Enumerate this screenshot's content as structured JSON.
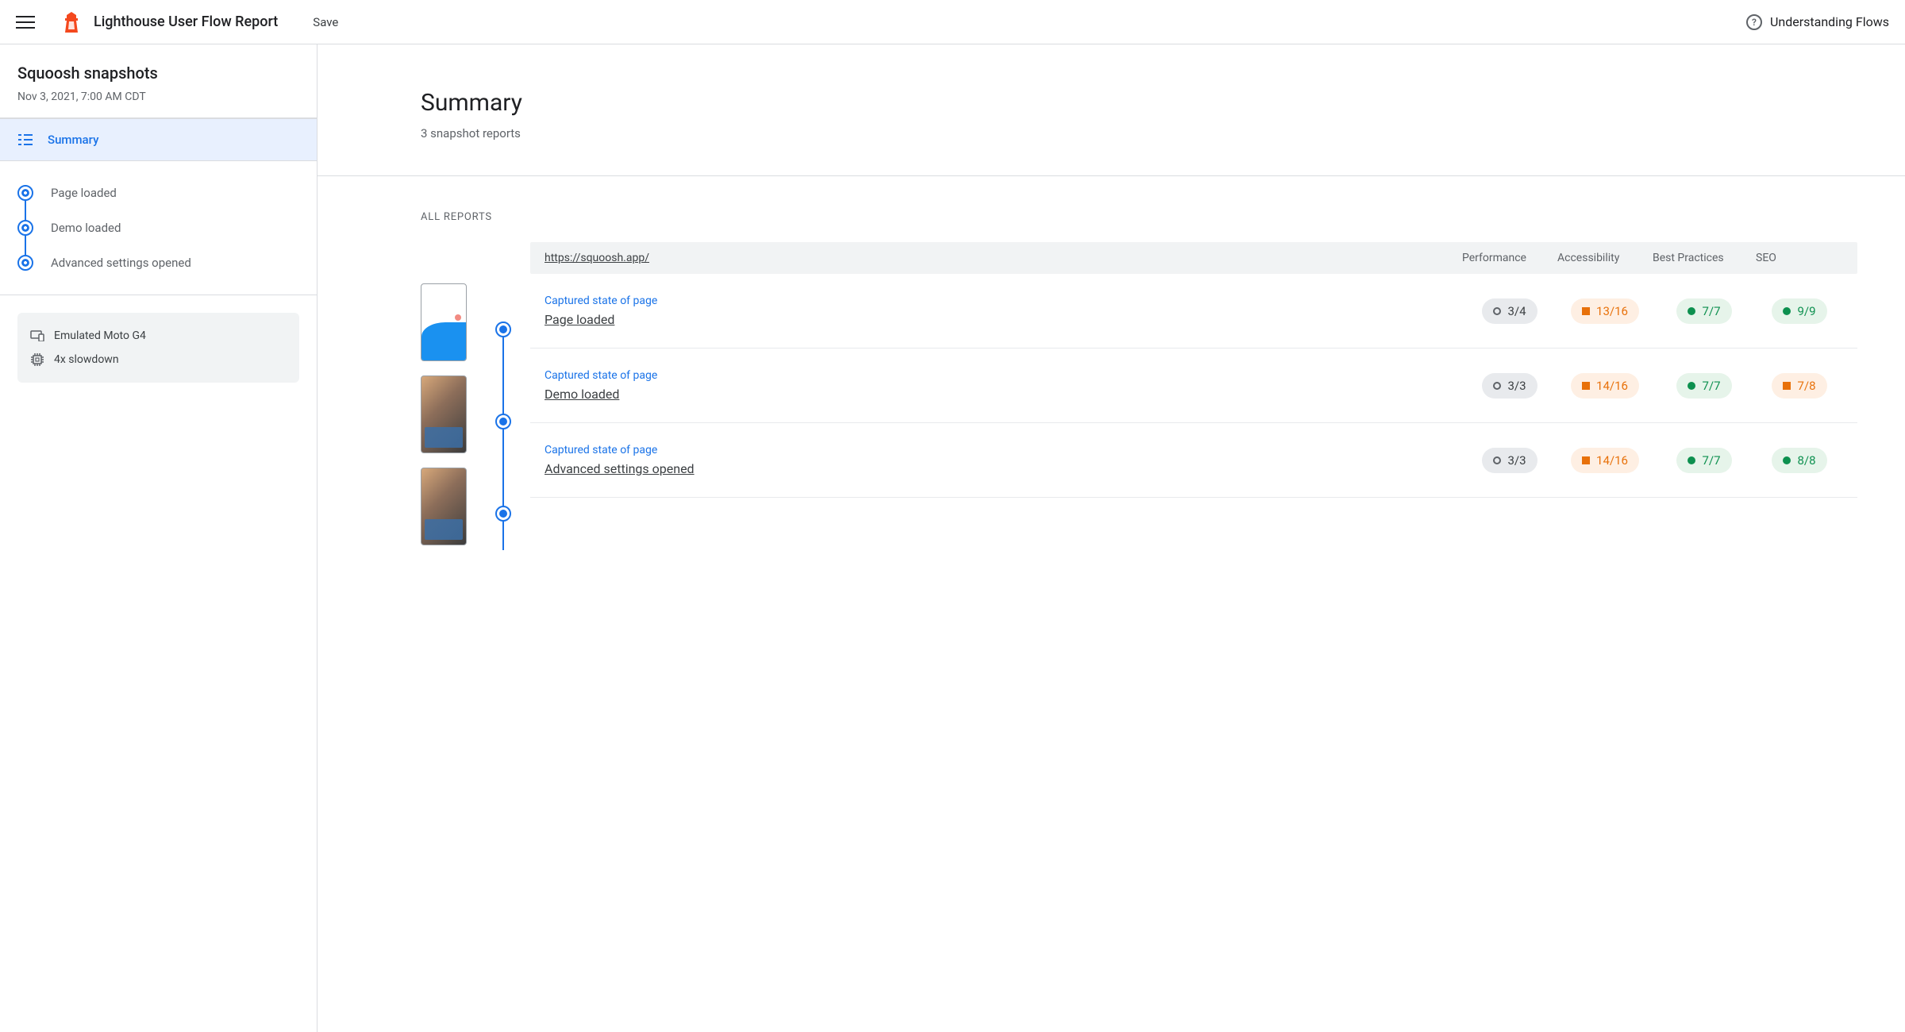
{
  "header": {
    "app_title": "Lighthouse User Flow Report",
    "save_label": "Save",
    "understanding_label": "Understanding Flows"
  },
  "sidebar": {
    "title": "Squoosh snapshots",
    "date": "Nov 3, 2021, 7:00 AM CDT",
    "summary_label": "Summary",
    "steps": [
      {
        "label": "Page loaded"
      },
      {
        "label": "Demo loaded"
      },
      {
        "label": "Advanced settings opened"
      }
    ],
    "meta": {
      "device": "Emulated Moto G4",
      "throttle": "4x slowdown"
    }
  },
  "main": {
    "summary_title": "Summary",
    "summary_sub": "3 snapshot reports",
    "all_reports_label": "ALL REPORTS",
    "url": "https://squoosh.app/",
    "columns": {
      "perf": "Performance",
      "a11y": "Accessibility",
      "bp": "Best Practices",
      "seo": "SEO"
    },
    "caption": "Captured state of page",
    "rows": [
      {
        "title": "Page loaded",
        "perf": {
          "score": "3/4",
          "status": "neutral"
        },
        "a11y": {
          "score": "13/16",
          "status": "warn"
        },
        "bp": {
          "score": "7/7",
          "status": "pass"
        },
        "seo": {
          "score": "9/9",
          "status": "pass"
        }
      },
      {
        "title": "Demo loaded",
        "perf": {
          "score": "3/3",
          "status": "neutral"
        },
        "a11y": {
          "score": "14/16",
          "status": "warn"
        },
        "bp": {
          "score": "7/7",
          "status": "pass"
        },
        "seo": {
          "score": "7/8",
          "status": "warn"
        }
      },
      {
        "title": "Advanced settings opened",
        "perf": {
          "score": "3/3",
          "status": "neutral"
        },
        "a11y": {
          "score": "14/16",
          "status": "warn"
        },
        "bp": {
          "score": "7/7",
          "status": "pass"
        },
        "seo": {
          "score": "8/8",
          "status": "pass"
        }
      }
    ]
  }
}
